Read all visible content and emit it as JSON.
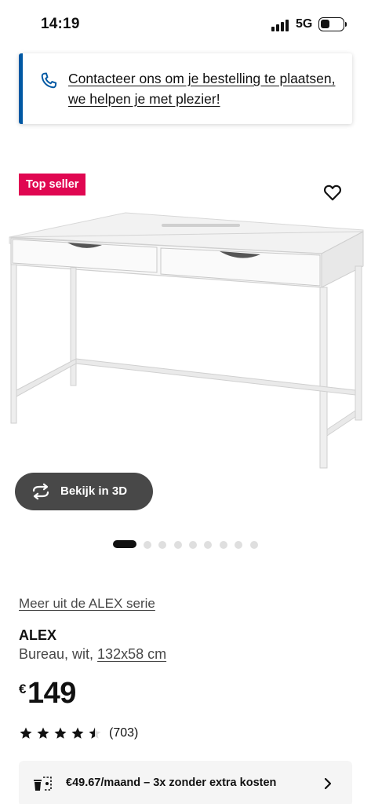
{
  "status_bar": {
    "time": "14:19",
    "network": "5G",
    "battery_level": 0.4
  },
  "contact_banner": {
    "text": "Contacteer ons om je bestelling te plaatsen, we helpen je met plezier!",
    "accent_color": "#0058a3"
  },
  "gallery": {
    "badge": "Top seller",
    "badge_color": "#e00751",
    "view_3d_label": "Bekijk in 3D",
    "dots_count": 9,
    "active_dot": 0
  },
  "product": {
    "series_link": "Meer uit de ALEX serie",
    "name": "ALEX",
    "description_prefix": "Bureau, wit, ",
    "dimensions": "132x58 cm",
    "currency": "€",
    "price": "149",
    "rating": 4.5,
    "rating_count": "(703)"
  },
  "installment": {
    "text": "€49.67/maand – 3x zonder extra kosten"
  },
  "icons": [
    "phone-icon",
    "heart-icon",
    "rotate-icon",
    "star-icon",
    "star-half-icon",
    "installment-icon",
    "chevron-right-icon"
  ]
}
